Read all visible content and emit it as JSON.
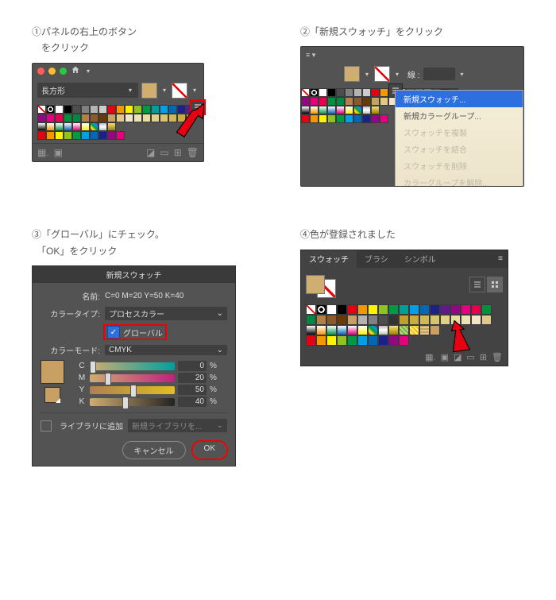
{
  "steps": {
    "s1": {
      "caption_l1": "①パネルの右上のボタン",
      "caption_l2": "　をクリック",
      "shape_select": "長方形",
      "menu_aria": "panel-menu"
    },
    "s2": {
      "caption": "②「新規スウォッチ」をクリック",
      "stroke_label": "線 :",
      "menu": {
        "new_swatch": "新規スウォッチ...",
        "new_color_group": "新規カラーグループ...",
        "dup": "スウォッチを複製",
        "merge": "スウォッチを結合",
        "del": "スウォッチを削除",
        "ungroup": "カラーグループを解除..."
      }
    },
    "s3": {
      "caption_l1": "③「グローバル」にチェック。",
      "caption_l2": "　「OK」をクリック",
      "dialog_title": "新規スウォッチ",
      "name_label": "名前:",
      "name_value": "C=0 M=20 Y=50 K=40",
      "type_label": "カラータイプ:",
      "type_value": "プロセスカラー",
      "global_label": "グローバル",
      "mode_label": "カラーモード:",
      "mode_value": "CMYK",
      "cmyk": {
        "c": "0",
        "m": "20",
        "y": "50",
        "k": "40"
      },
      "pct": "%",
      "add_lib_label": "ライブラリに追加",
      "add_lib_placeholder": "新規ライブラリを...",
      "cancel": "キャンセル",
      "ok": "OK"
    },
    "s4": {
      "caption": "④色が登録されました",
      "tabs": {
        "swatch": "スウォッチ",
        "brush": "ブラシ",
        "symbol": "シンボル"
      }
    }
  },
  "swatch_palette": {
    "row_a": [
      "none",
      "reg",
      "#ffffff",
      "#000000",
      "#4d4d4d",
      "#808080",
      "#b3b3b3",
      "#cccccc",
      "#e60012",
      "#f39800",
      "#fff100",
      "#8fc31f",
      "#009944",
      "#009e96",
      "#00a0e9",
      "#0068b7",
      "#1d2088",
      "#601986"
    ],
    "row_b": [
      "#920783",
      "#e4007f",
      "#e5004f",
      "#00913a",
      "#008842",
      "#b28146",
      "#8a5a2b",
      "#6a3906",
      "#c9a063",
      "#e0c78a",
      "#f2e6c9",
      "#ede2b2",
      "#e8dca0",
      "#e0d088",
      "#d8c470",
      "#d0b858",
      "#c8ac40",
      "#c0a028"
    ],
    "row_c_grad": [
      "linear-gradient(#fff,#000)",
      "linear-gradient(#fff,#f39800)",
      "linear-gradient(#fff,#009944)",
      "linear-gradient(#fff,#0068b7)",
      "linear-gradient(#fff,#e4007f)",
      "linear-gradient(#fff,#fff100)",
      "linear-gradient(45deg,#e60012,#fff100,#009944,#00a0e9,#920783)",
      "linear-gradient(#bbb,#fff,#bbb)",
      "linear-gradient(#f6e27a,#a47a00)"
    ],
    "row_d_groups": [
      "#e60012",
      "#f39800",
      "#fff100",
      "#8fc31f",
      "#009944",
      "#00a0e9",
      "#0068b7",
      "#1d2088",
      "#920783",
      "#e4007f"
    ]
  },
  "swatch_palette_v4": {
    "row_a": [
      "none",
      "reg",
      "#ffffff",
      "#000000",
      "#e60012",
      "#f39800",
      "#fff100",
      "#8fc31f",
      "#009944",
      "#009e96",
      "#00a0e9",
      "#0068b7",
      "#1d2088",
      "#601986",
      "#920783",
      "#e4007f",
      "#e5004f",
      "#00913a"
    ],
    "row_b": [
      "#008842",
      "#b28146",
      "#8a5a2b",
      "#6a3906",
      "#c9a063",
      "#b3b3b3",
      "#808080",
      "#4d4d4d",
      "#333333",
      "#c0a028",
      "#c8ac40",
      "#d0b858",
      "#d8c470",
      "#e0d088",
      "#e8dca0",
      "#ede2b2",
      "#f2e6c9",
      "#e0c78a"
    ],
    "row_c": [
      "linear-gradient(#fff,#000)",
      "linear-gradient(#fff,#f39800)",
      "linear-gradient(#fff,#009944)",
      "linear-gradient(#fff,#0068b7)",
      "linear-gradient(#fff,#e4007f)",
      "linear-gradient(#fff,#fff100)",
      "linear-gradient(45deg,#e60012,#fff100,#009944,#00a0e9,#920783)",
      "linear-gradient(#bbb,#fff,#bbb)",
      "linear-gradient(#f6e27a,#a47a00)",
      "repeating-linear-gradient(45deg,#7a5 0 2px,#bd7 2px 4px)",
      "repeating-linear-gradient(45deg,#fb0 0 2px,#fe8 2px 4px)",
      "repeating-linear-gradient(0deg,#e0c78a 0 2px,#c9a063 2px 4px)",
      "#c9a063"
    ],
    "row_d": [
      "#e60012",
      "#f39800",
      "#fff100",
      "#8fc31f",
      "#009944",
      "#00a0e9",
      "#0068b7",
      "#1d2088",
      "#920783",
      "#e4007f"
    ]
  },
  "colors": {
    "fill_preview": "#c9a063",
    "highlight": "#e00",
    "menu_sel": "#2e6fe0"
  }
}
